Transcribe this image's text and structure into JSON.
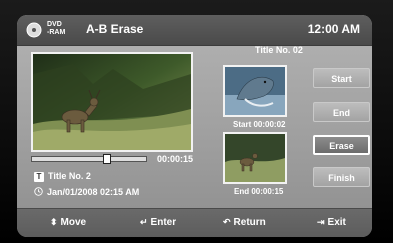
{
  "header": {
    "disc_line1": "DVD",
    "disc_line2": "-RAM",
    "title": "A-B Erase",
    "time": "12:00 AM",
    "disc_icon": "disc-icon"
  },
  "preview": {
    "progress_time": "00:00:15",
    "progress_fraction": 0.76,
    "title_badge": "T",
    "title_label": "Title No. 2",
    "date_label": "Jan/01/2008  02:15 AM",
    "image": "deer-in-grass"
  },
  "right_panel": {
    "title": "Title No. 02",
    "start_caption": "Start 00:00:02",
    "end_caption": "End 00:00:15",
    "start_image": "dolphin",
    "end_image": "deer-in-grass"
  },
  "buttons": {
    "start": "Start",
    "end": "End",
    "erase": "Erase",
    "finish": "Finish"
  },
  "footer": {
    "move": "Move",
    "enter": "Enter",
    "return": "Return",
    "exit": "Exit"
  },
  "colors": {
    "panel": "#a6a6a6",
    "header": "#555555",
    "selected_button": "#7a7a7a",
    "text": "#ffffff"
  }
}
